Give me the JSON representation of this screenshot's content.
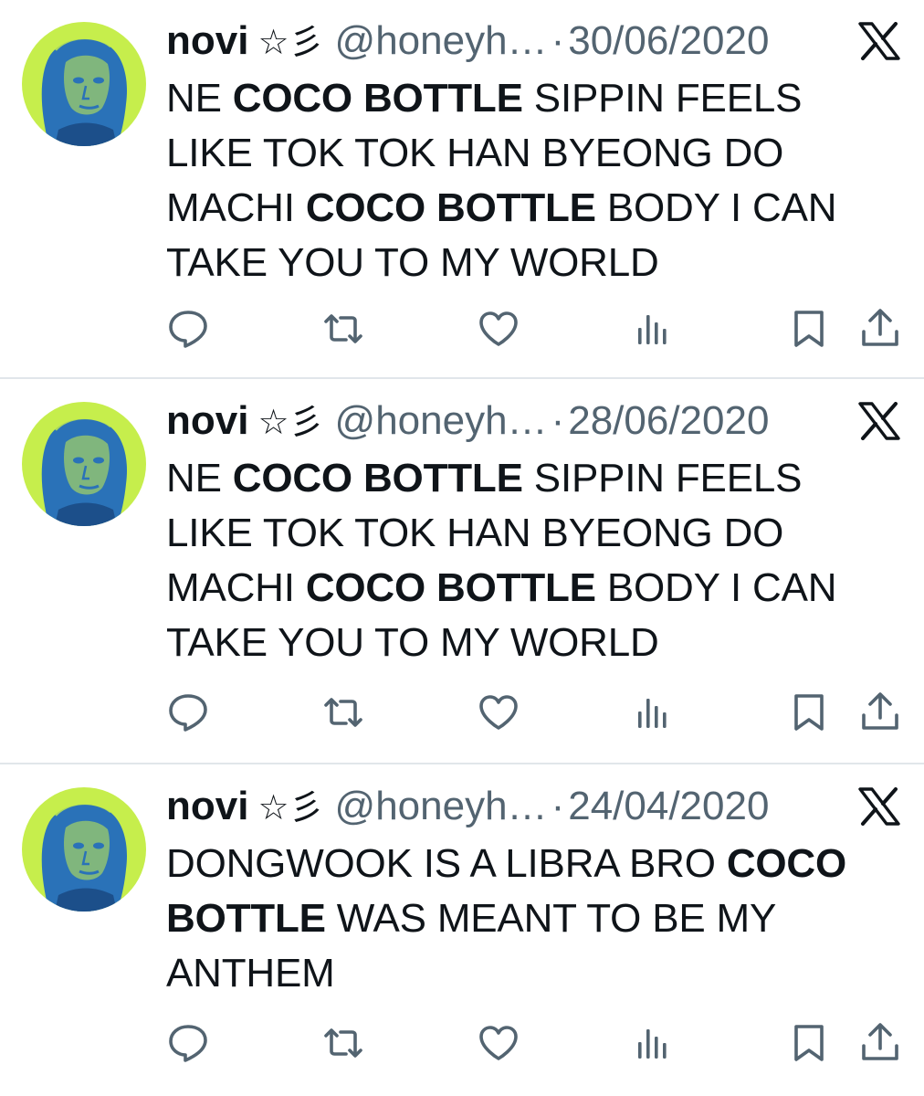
{
  "colors": {
    "text_primary": "#0f1419",
    "text_secondary": "#536471",
    "divider": "#e1e6ea",
    "avatar_green": "#c6ee4c",
    "avatar_blue": "#2a72b8"
  },
  "tweets": [
    {
      "author": {
        "display_name": "novi",
        "name_emoji": "☆彡",
        "handle": "@honeyh…"
      },
      "separator": "·",
      "date": "30/06/2020",
      "source_icon": "x-logo-icon",
      "text_parts": [
        {
          "text": "NE ",
          "bold": false
        },
        {
          "text": "COCO BOTTLE",
          "bold": true
        },
        {
          "text": " SIPPIN FEELS LIKE TOK TOK HAN BYEONG DO MACHI ",
          "bold": false
        },
        {
          "text": "COCO BOTTLE",
          "bold": true
        },
        {
          "text": " BODY I CAN TAKE YOU TO MY WORLD",
          "bold": false
        }
      ],
      "actions": [
        "reply-icon",
        "retweet-icon",
        "like-icon",
        "views-icon",
        "bookmark-icon",
        "share-icon"
      ]
    },
    {
      "author": {
        "display_name": "novi",
        "name_emoji": "☆彡",
        "handle": "@honeyh…"
      },
      "separator": "·",
      "date": "28/06/2020",
      "source_icon": "x-logo-icon",
      "text_parts": [
        {
          "text": "NE ",
          "bold": false
        },
        {
          "text": "COCO BOTTLE",
          "bold": true
        },
        {
          "text": " SIPPIN FEELS LIKE TOK TOK HAN BYEONG DO MACHI ",
          "bold": false
        },
        {
          "text": "COCO BOTTLE",
          "bold": true
        },
        {
          "text": " BODY I CAN TAKE YOU TO MY WORLD",
          "bold": false
        }
      ],
      "actions": [
        "reply-icon",
        "retweet-icon",
        "like-icon",
        "views-icon",
        "bookmark-icon",
        "share-icon"
      ]
    },
    {
      "author": {
        "display_name": "novi",
        "name_emoji": "☆彡",
        "handle": "@honeyh…"
      },
      "separator": "·",
      "date": "24/04/2020",
      "source_icon": "x-logo-icon",
      "text_parts": [
        {
          "text": "DONGWOOK IS A LIBRA BRO ",
          "bold": false
        },
        {
          "text": "COCO BOTTLE",
          "bold": true
        },
        {
          "text": " WAS MEANT TO BE MY ANTHEM",
          "bold": false
        }
      ],
      "actions": [
        "reply-icon",
        "retweet-icon",
        "like-icon",
        "views-icon",
        "bookmark-icon",
        "share-icon"
      ]
    }
  ]
}
